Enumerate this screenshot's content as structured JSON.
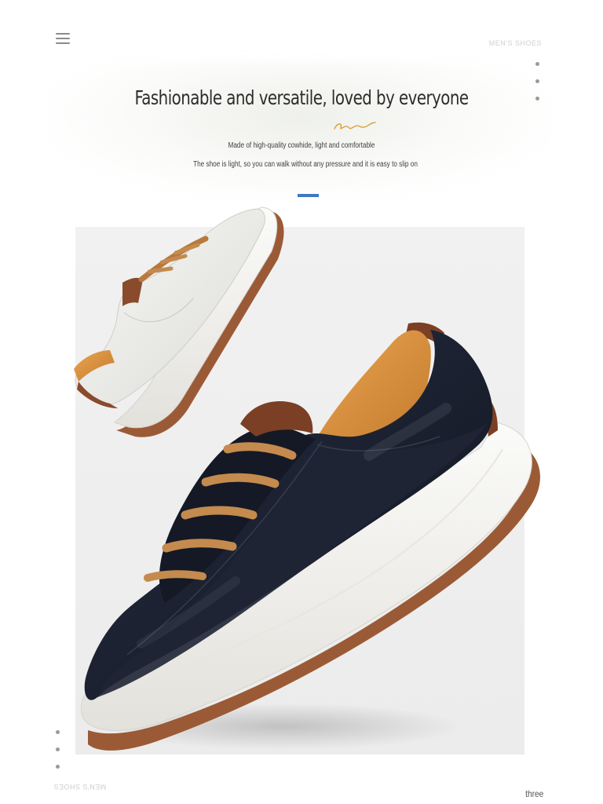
{
  "header": {
    "brand": "MEN'S SHOES"
  },
  "hero": {
    "title": "Fashionable and versatile, loved by everyone",
    "subtitle": "Made of high-quality cowhide, light and comfortable",
    "description": "The shoe is light, so you can walk without any pressure and it is easy to slip on"
  },
  "footer": {
    "brand_mirrored": "MEN'S SHOES",
    "page_label": "three"
  },
  "colors": {
    "accent": "#3f78c1",
    "signature": "#d9a13a",
    "leather_dark": "#1c2230",
    "leather_tan": "#c48a4e",
    "sole_brown": "#9b5a36"
  },
  "icons": {
    "menu": "hamburger-menu-icon",
    "signature": "signature-flourish-icon"
  }
}
